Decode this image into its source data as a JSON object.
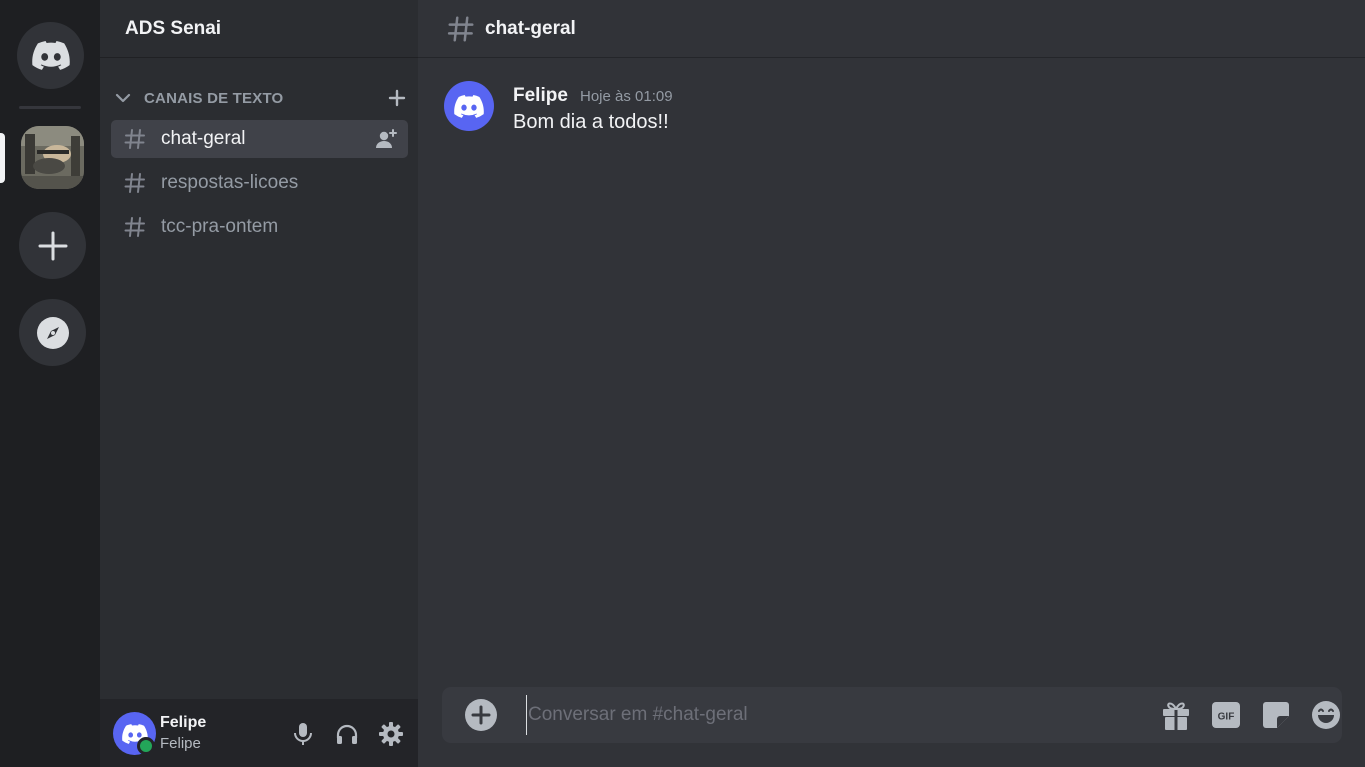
{
  "server": {
    "name": "ADS Senai"
  },
  "rail": {
    "home_icon": "discord-logo-icon",
    "server_icon": "server-image",
    "add_icon": "plus-icon",
    "explore_icon": "compass-icon"
  },
  "category": {
    "label": "CANAIS DE TEXTO"
  },
  "channels": [
    {
      "name": "chat-geral",
      "active": true
    },
    {
      "name": "respostas-licoes",
      "active": false
    },
    {
      "name": "tcc-pra-ontem",
      "active": false
    }
  ],
  "current_channel": {
    "name": "chat-geral"
  },
  "messages": [
    {
      "author": "Felipe",
      "timestamp": "Hoje às 01:09",
      "text": "Bom dia a todos!!"
    }
  ],
  "composer": {
    "placeholder": "Conversar em #chat-geral"
  },
  "user": {
    "name": "Felipe",
    "tag": "Felipe",
    "status": "online"
  },
  "colors": {
    "blurple": "#5865f2",
    "online": "#23a559",
    "rail_bg": "#1e1f22",
    "sidebar_bg": "#2b2d31",
    "main_bg": "#313338"
  }
}
